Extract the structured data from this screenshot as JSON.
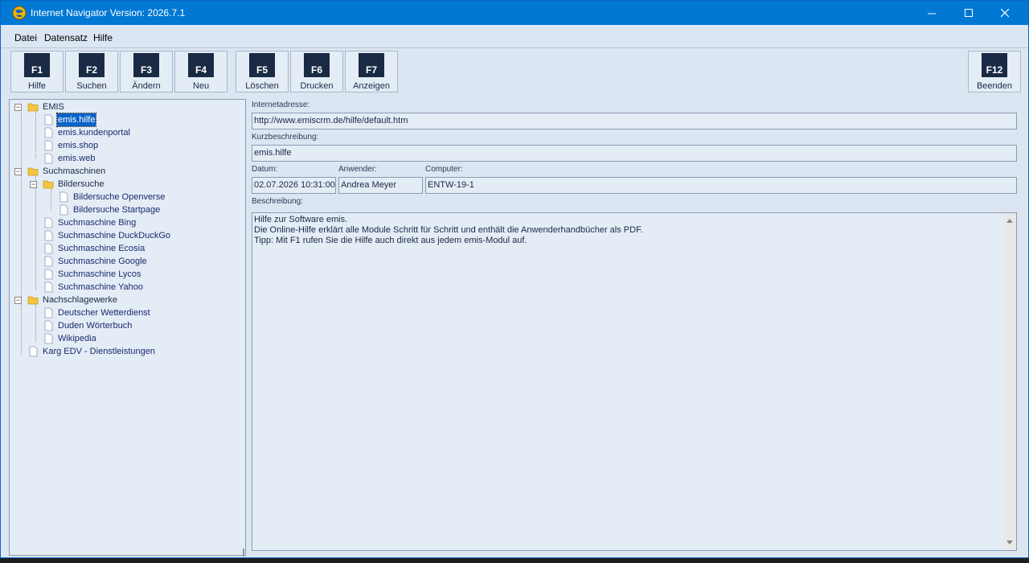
{
  "window": {
    "title": "Internet Navigator Version: 2026.7.1"
  },
  "menu": {
    "items": [
      "Datei",
      "Datensatz",
      "Hilfe"
    ]
  },
  "toolbar": {
    "buttons": [
      {
        "key": "F1",
        "label": "Hilfe"
      },
      {
        "key": "F2",
        "label": "Suchen"
      },
      {
        "key": "F3",
        "label": "Ändern"
      },
      {
        "key": "F4",
        "label": "Neu"
      },
      {
        "key": "F5",
        "label": "Löschen"
      },
      {
        "key": "F6",
        "label": "Drucken"
      },
      {
        "key": "F7",
        "label": "Anzeigen"
      },
      {
        "key": "F12",
        "label": "Beenden"
      }
    ]
  },
  "tree": {
    "nodes": [
      "EMIS",
      "emis.hilfe",
      "emis.kundenportal",
      "emis.shop",
      "emis.web",
      "Suchmaschinen",
      "Bildersuche",
      "Bildersuche Openverse",
      "Bildersuche Startpage",
      "Suchmaschine Bing",
      "Suchmaschine DuckDuckGo",
      "Suchmaschine Ecosia",
      "Suchmaschine Google",
      "Suchmaschine Lycos",
      "Suchmaschine Yahoo",
      "Nachschlagewerke",
      "Deutscher Wetterdienst",
      "Duden Wörterbuch",
      "Wikipedia",
      "Karg EDV - Dienstleistungen"
    ],
    "selected": "emis.hilfe"
  },
  "details": {
    "url_label": "Internetadresse:",
    "url": "http://www.emiscrm.de/hilfe/default.htm",
    "short_label": "Kurzbeschreibung:",
    "short": "emis.hilfe",
    "date_label": "Datum:",
    "date": "02.07.2026 10:31:00",
    "user_label": "Anwender:",
    "user": "Andrea Meyer",
    "computer_label": "Computer:",
    "computer": "ENTW-19-1",
    "desc_label": "Beschreibung:",
    "desc_lines": [
      "Hilfe zur Software emis.",
      "Die Online-Hilfe erklärt alle Module Schritt für Schritt und enthält die Anwenderhandbücher als PDF.",
      "Tipp: Mit F1 rufen Sie die Hilfe auch direkt aus jedem emis-Modul auf."
    ]
  }
}
